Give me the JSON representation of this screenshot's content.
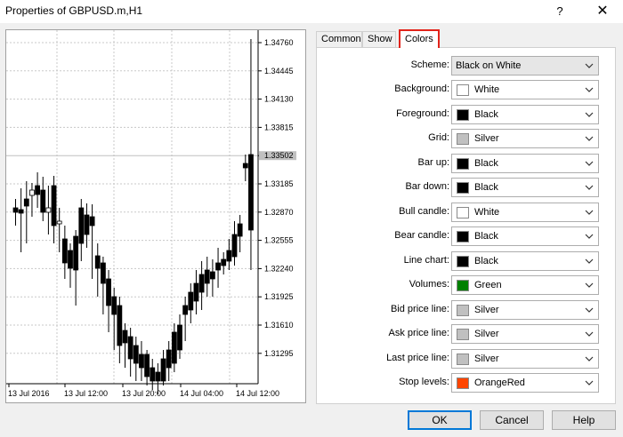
{
  "window": {
    "title": "Properties of GBPUSD.m,H1",
    "help_label": "?",
    "close_label": "✕"
  },
  "chart": {
    "price_labels": [
      "1.34760",
      "1.34445",
      "1.34130",
      "1.33815",
      "1.33502",
      "1.33185",
      "1.32870",
      "1.32555",
      "1.32240",
      "1.31925",
      "1.31610",
      "1.31295"
    ],
    "current_price": "1.33502",
    "time_labels": [
      "13 Jul 2016",
      "13 Jul 12:00",
      "13 Jul 20:00",
      "14 Jul 04:00",
      "14 Jul 12:00"
    ]
  },
  "tabs": [
    {
      "label": "Common",
      "active": false
    },
    {
      "label": "Show",
      "active": false
    },
    {
      "label": "Colors",
      "active": true
    }
  ],
  "colors": {
    "scheme": {
      "label": "Scheme:",
      "value": "Black on White"
    },
    "rows": [
      {
        "label": "Background:",
        "value": "White",
        "swatch": "#ffffff"
      },
      {
        "label": "Foreground:",
        "value": "Black",
        "swatch": "#000000"
      },
      {
        "label": "Grid:",
        "value": "Silver",
        "swatch": "#c0c0c0"
      },
      {
        "label": "Bar up:",
        "value": "Black",
        "swatch": "#000000"
      },
      {
        "label": "Bar down:",
        "value": "Black",
        "swatch": "#000000"
      },
      {
        "label": "Bull candle:",
        "value": "White",
        "swatch": "#ffffff"
      },
      {
        "label": "Bear candle:",
        "value": "Black",
        "swatch": "#000000"
      },
      {
        "label": "Line chart:",
        "value": "Black",
        "swatch": "#000000"
      },
      {
        "label": "Volumes:",
        "value": "Green",
        "swatch": "#008000"
      },
      {
        "label": "Bid price line:",
        "value": "Silver",
        "swatch": "#c0c0c0"
      },
      {
        "label": "Ask price line:",
        "value": "Silver",
        "swatch": "#c0c0c0"
      },
      {
        "label": "Last price line:",
        "value": "Silver",
        "swatch": "#c0c0c0"
      },
      {
        "label": "Stop levels:",
        "value": "OrangeRed",
        "swatch": "#ff4500"
      }
    ]
  },
  "buttons": {
    "ok": "OK",
    "cancel": "Cancel",
    "help": "Help"
  }
}
